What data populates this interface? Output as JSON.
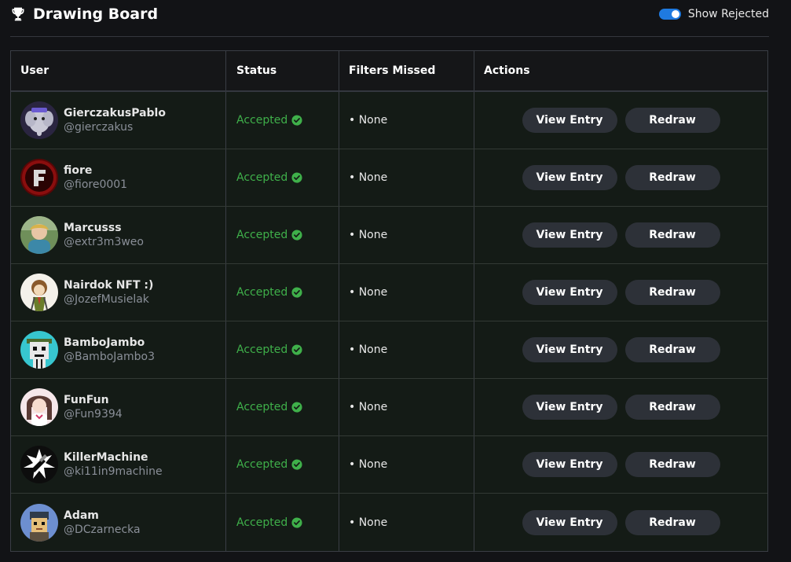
{
  "header": {
    "title": "Drawing Board",
    "icon": "trophy-icon",
    "toggle_label": "Show Rejected",
    "toggle_on": true
  },
  "table": {
    "columns": [
      "User",
      "Status",
      "Filters Missed",
      "Actions"
    ],
    "rows": [
      {
        "name": "GierczakusPablo",
        "handle": "@gierczakus",
        "status": "Accepted",
        "filters": "• None",
        "view_label": "View Entry",
        "redraw_label": "Redraw"
      },
      {
        "name": "fiore",
        "handle": "@fiore0001",
        "status": "Accepted",
        "filters": "• None",
        "view_label": "View Entry",
        "redraw_label": "Redraw"
      },
      {
        "name": "Marcusss",
        "handle": "@extr3m3weo",
        "status": "Accepted",
        "filters": "• None",
        "view_label": "View Entry",
        "redraw_label": "Redraw"
      },
      {
        "name": "Nairdok NFT :)",
        "handle": "@JozefMusielak",
        "status": "Accepted",
        "filters": "• None",
        "view_label": "View Entry",
        "redraw_label": "Redraw"
      },
      {
        "name": "BamboJambo",
        "handle": "@BamboJambo3",
        "status": "Accepted",
        "filters": "• None",
        "view_label": "View Entry",
        "redraw_label": "Redraw"
      },
      {
        "name": "FunFun",
        "handle": "@Fun9394",
        "status": "Accepted",
        "filters": "• None",
        "view_label": "View Entry",
        "redraw_label": "Redraw"
      },
      {
        "name": "KillerMachine",
        "handle": "@ki11in9machine",
        "status": "Accepted",
        "filters": "• None",
        "view_label": "View Entry",
        "redraw_label": "Redraw"
      },
      {
        "name": "Adam",
        "handle": "@DCzarnecka",
        "status": "Accepted",
        "filters": "• None",
        "view_label": "View Entry",
        "redraw_label": "Redraw"
      }
    ]
  },
  "colors": {
    "accent_toggle": "#1f7ae0",
    "status_accepted": "#3fb04a",
    "button_bg": "#2d3138"
  }
}
